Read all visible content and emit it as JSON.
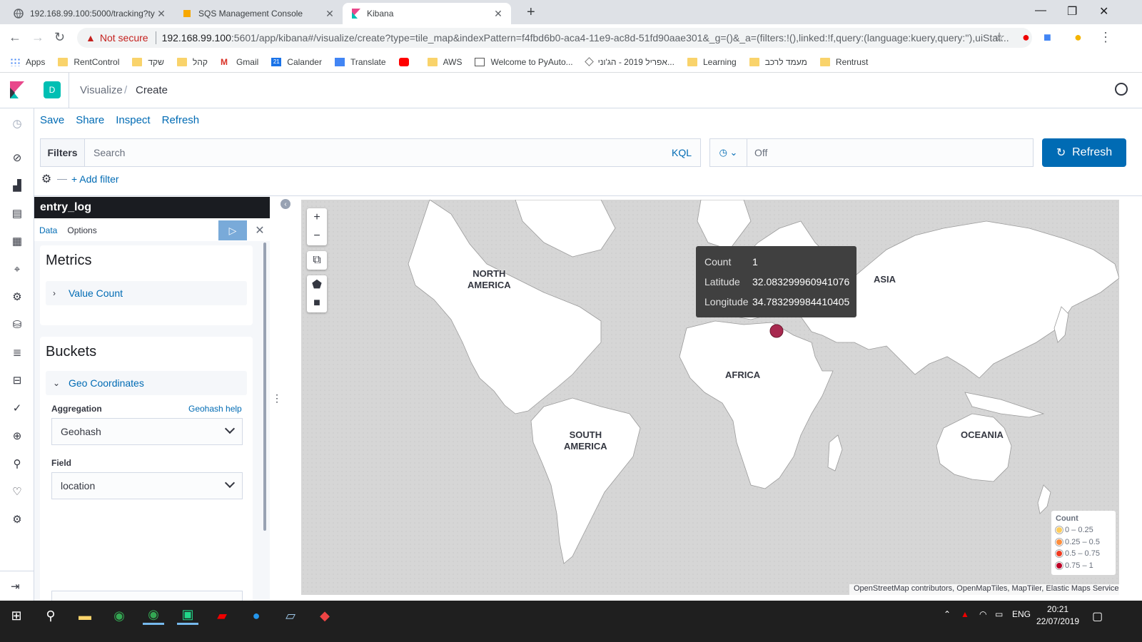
{
  "browser": {
    "tabs": [
      {
        "title": "192.168.99.100:5000/tracking?ty",
        "favicon": "globe-icon"
      },
      {
        "title": "SQS Management Console",
        "favicon": "aws-cube-icon"
      },
      {
        "title": "Kibana",
        "favicon": "kibana-icon"
      }
    ],
    "address": {
      "warning": "Not secure",
      "host": "192.168.99.100",
      "rest": ":5601/app/kibana#/visualize/create?type=tile_map&indexPattern=f4fbd6b0-aca4-11e9-ac8d-51fd90aae301&_g=()&_a=(filters:!(),linked:!f,query:(language:kuery,query:''),uiStat..."
    },
    "bookmarks": [
      {
        "label": "Apps",
        "icon": "apps-grid-icon"
      },
      {
        "label": "RentControl",
        "icon": "folder-icon"
      },
      {
        "label": "שקד",
        "icon": "folder-icon"
      },
      {
        "label": "קהל",
        "icon": "folder-icon"
      },
      {
        "label": "Gmail",
        "icon": "gmail-icon"
      },
      {
        "label": "Calander",
        "icon": "calendar-icon"
      },
      {
        "label": "Translate",
        "icon": "translate-icon"
      },
      {
        "label": "",
        "icon": "youtube-icon"
      },
      {
        "label": "AWS",
        "icon": "folder-icon"
      },
      {
        "label": "Welcome to PyAuto...",
        "icon": "page-icon"
      },
      {
        "label": "אפריל 2019 - הג'וני...",
        "icon": "tag-icon"
      },
      {
        "label": "Learning",
        "icon": "folder-icon"
      },
      {
        "label": "מעמד לרכב",
        "icon": "folder-icon"
      },
      {
        "label": "Rentrust",
        "icon": "folder-icon"
      }
    ]
  },
  "kibana": {
    "space_letter": "D",
    "breadcrumbs": [
      "Visualize",
      "Create"
    ],
    "menu": [
      "Save",
      "Share",
      "Inspect",
      "Refresh"
    ],
    "filters_label": "Filters",
    "search_placeholder": "Search",
    "kql": "KQL",
    "time_value": "Off",
    "refresh_button": "Refresh",
    "add_filter": "+ Add filter"
  },
  "sidebar": {
    "index_title": "entry_log",
    "tabs": [
      "Data",
      "Options"
    ],
    "metrics_title": "Metrics",
    "metric_item": "Value Count",
    "buckets_title": "Buckets",
    "bucket_item": "Geo Coordinates",
    "aggregation_label": "Aggregation",
    "geohash_help": "Geohash help",
    "aggregation_value": "Geohash",
    "field_label": "Field",
    "field_value": "location"
  },
  "map": {
    "continents": [
      "NORTH AMERICA",
      "SOUTH AMERICA",
      "AFRICA",
      "ASIA",
      "OCEANIA"
    ],
    "tooltip": {
      "count_label": "Count",
      "count_value": "1",
      "lat_label": "Latitude",
      "lat_value": "32.083299960941076",
      "lon_label": "Longitude",
      "lon_value": "34.783299984410405"
    },
    "legend": {
      "title": "Count",
      "items": [
        {
          "label": "0 – 0.25",
          "color": "#fecc5c"
        },
        {
          "label": "0.25 – 0.5",
          "color": "#fd8d3c"
        },
        {
          "label": "0.5 – 0.75",
          "color": "#f03b20"
        },
        {
          "label": "0.75 – 1",
          "color": "#bd0026"
        }
      ]
    },
    "marker_color": "#a8294f",
    "attribution": "OpenStreetMap contributors, OpenMapTiles, MapTiler, Elastic Maps Service"
  },
  "taskbar": {
    "language": "ENG",
    "time": "20:21",
    "date": "22/07/2019"
  }
}
